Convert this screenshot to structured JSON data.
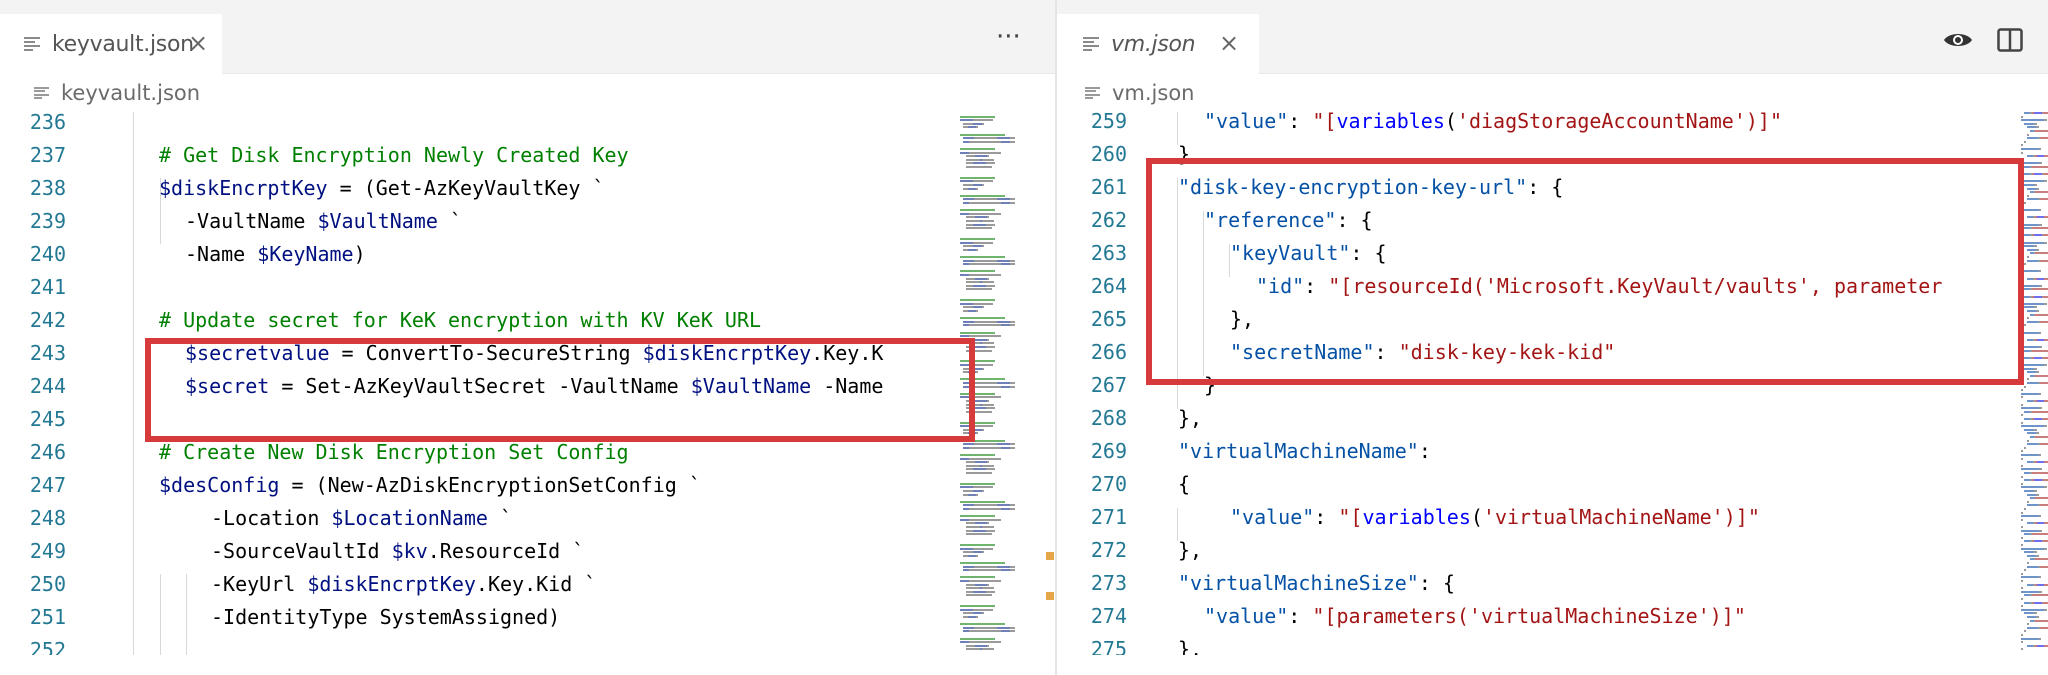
{
  "left_editor": {
    "tab": {
      "label": "keyvault.json",
      "close_glyph": "×"
    },
    "more_actions_glyph": "···",
    "breadcrumb": "keyvault.json",
    "lines": [
      {
        "number": "236",
        "indent": 0,
        "tokens": []
      },
      {
        "number": "237",
        "indent": 0,
        "tokens": [
          {
            "t": "# Get Disk Encryption Newly Created Key",
            "c": "c-comment"
          }
        ]
      },
      {
        "number": "238",
        "indent": 0,
        "tokens": [
          {
            "t": "$diskEncrptKey",
            "c": "c-var"
          },
          {
            "t": " = (Get-AzKeyVaultKey `",
            "c": "c-op"
          }
        ]
      },
      {
        "number": "239",
        "indent": 1,
        "tokens": [
          {
            "t": "-VaultName ",
            "c": "c-op"
          },
          {
            "t": "$VaultName",
            "c": "c-var"
          },
          {
            "t": " `",
            "c": "c-op"
          }
        ]
      },
      {
        "number": "240",
        "indent": 1,
        "tokens": [
          {
            "t": "-Name ",
            "c": "c-op"
          },
          {
            "t": "$KeyName",
            "c": "c-var"
          },
          {
            "t": ")",
            "c": "c-op"
          }
        ]
      },
      {
        "number": "241",
        "indent": 0,
        "tokens": []
      },
      {
        "number": "242",
        "indent": 0,
        "tokens": [
          {
            "t": "# Update secret for KeK encryption with KV KeK URL",
            "c": "c-comment"
          }
        ]
      },
      {
        "number": "243",
        "indent": 1,
        "tokens": [
          {
            "t": "$secretvalue",
            "c": "c-var"
          },
          {
            "t": " = ConvertTo-SecureString ",
            "c": "c-op"
          },
          {
            "t": "$diskEncrptKey",
            "c": "c-var"
          },
          {
            "t": ".Key.K",
            "c": "c-op"
          }
        ]
      },
      {
        "number": "244",
        "indent": 1,
        "tokens": [
          {
            "t": "$secret",
            "c": "c-var"
          },
          {
            "t": " = Set-AzKeyVaultSecret -VaultName ",
            "c": "c-op"
          },
          {
            "t": "$VaultName",
            "c": "c-var"
          },
          {
            "t": " -Name",
            "c": "c-op"
          }
        ]
      },
      {
        "number": "245",
        "indent": 0,
        "tokens": []
      },
      {
        "number": "246",
        "indent": 0,
        "tokens": [
          {
            "t": "# Create New Disk Encryption Set Config",
            "c": "c-comment"
          }
        ]
      },
      {
        "number": "247",
        "indent": 0,
        "tokens": [
          {
            "t": "$desConfig",
            "c": "c-var"
          },
          {
            "t": " = (New-AzDiskEncryptionSetConfig `",
            "c": "c-op"
          }
        ]
      },
      {
        "number": "248",
        "indent": 2,
        "tokens": [
          {
            "t": "-Location ",
            "c": "c-op"
          },
          {
            "t": "$LocationName",
            "c": "c-var"
          },
          {
            "t": " `",
            "c": "c-op"
          }
        ]
      },
      {
        "number": "249",
        "indent": 2,
        "tokens": [
          {
            "t": "-SourceVaultId ",
            "c": "c-op"
          },
          {
            "t": "$kv",
            "c": "c-var"
          },
          {
            "t": ".ResourceId `",
            "c": "c-op"
          }
        ]
      },
      {
        "number": "250",
        "indent": 2,
        "tokens": [
          {
            "t": "-KeyUrl ",
            "c": "c-op"
          },
          {
            "t": "$diskEncrptKey",
            "c": "c-var"
          },
          {
            "t": ".Key.Kid `",
            "c": "c-op"
          }
        ]
      },
      {
        "number": "251",
        "indent": 2,
        "tokens": [
          {
            "t": "-IdentityType SystemAssigned)",
            "c": "c-op"
          }
        ]
      },
      {
        "number": "252",
        "indent": 0,
        "tokens": []
      }
    ]
  },
  "right_editor": {
    "tab": {
      "label": "vm.json",
      "close_glyph": "×"
    },
    "actions": [
      {
        "icon": "eye-icon"
      },
      {
        "icon": "split-editor-icon"
      }
    ],
    "breadcrumb": "vm.json",
    "lines": [
      {
        "number": "259",
        "indent": 1,
        "tokens": [
          {
            "t": "\"value\"",
            "c": "c-key"
          },
          {
            "t": ": ",
            "c": "c-op"
          },
          {
            "t": "\"[",
            "c": "c-str"
          },
          {
            "t": "variables",
            "c": "c-fn"
          },
          {
            "t": "(",
            "c": "c-op"
          },
          {
            "t": "'diagStorageAccountName'",
            "c": "c-str"
          },
          {
            "t": ")]\"",
            "c": "c-str"
          }
        ]
      },
      {
        "number": "260",
        "indent": 0,
        "tokens": [
          {
            "t": "},",
            "c": "c-op"
          }
        ]
      },
      {
        "number": "261",
        "indent": 0,
        "tokens": [
          {
            "t": "\"disk-key-encryption-key-url\"",
            "c": "c-key"
          },
          {
            "t": ": {",
            "c": "c-op"
          }
        ]
      },
      {
        "number": "262",
        "indent": 1,
        "tokens": [
          {
            "t": "\"reference\"",
            "c": "c-key"
          },
          {
            "t": ": {",
            "c": "c-op"
          }
        ]
      },
      {
        "number": "263",
        "indent": 2,
        "tokens": [
          {
            "t": "\"keyVault\"",
            "c": "c-key"
          },
          {
            "t": ": {",
            "c": "c-op"
          }
        ]
      },
      {
        "number": "264",
        "indent": 3,
        "tokens": [
          {
            "t": "\"id\"",
            "c": "c-key"
          },
          {
            "t": ": ",
            "c": "c-op"
          },
          {
            "t": "\"[resourceId(",
            "c": "c-str"
          },
          {
            "t": "'Microsoft.KeyVault/vaults'",
            "c": "c-str"
          },
          {
            "t": ", parameter",
            "c": "c-str"
          }
        ]
      },
      {
        "number": "265",
        "indent": 2,
        "tokens": [
          {
            "t": "},",
            "c": "c-op"
          }
        ]
      },
      {
        "number": "266",
        "indent": 2,
        "tokens": [
          {
            "t": "\"secretName\"",
            "c": "c-key"
          },
          {
            "t": ": ",
            "c": "c-op"
          },
          {
            "t": "\"disk-key-kek-kid\"",
            "c": "c-str"
          }
        ]
      },
      {
        "number": "267",
        "indent": 1,
        "tokens": [
          {
            "t": "}",
            "c": "c-op"
          }
        ]
      },
      {
        "number": "268",
        "indent": 0,
        "tokens": [
          {
            "t": "},",
            "c": "c-op"
          }
        ]
      },
      {
        "number": "269",
        "indent": 0,
        "tokens": [
          {
            "t": "\"virtualMachineName\"",
            "c": "c-key"
          },
          {
            "t": ":",
            "c": "c-op"
          }
        ]
      },
      {
        "number": "270",
        "indent": 0,
        "tokens": [
          {
            "t": "{",
            "c": "c-op"
          }
        ]
      },
      {
        "number": "271",
        "indent": 2,
        "tokens": [
          {
            "t": "\"value\"",
            "c": "c-key"
          },
          {
            "t": ": ",
            "c": "c-op"
          },
          {
            "t": "\"[",
            "c": "c-str"
          },
          {
            "t": "variables",
            "c": "c-fn"
          },
          {
            "t": "(",
            "c": "c-op"
          },
          {
            "t": "'virtualMachineName'",
            "c": "c-str"
          },
          {
            "t": ")]\"",
            "c": "c-str"
          }
        ]
      },
      {
        "number": "272",
        "indent": 0,
        "tokens": [
          {
            "t": "},",
            "c": "c-op"
          }
        ]
      },
      {
        "number": "273",
        "indent": 0,
        "tokens": [
          {
            "t": "\"virtualMachineSize\"",
            "c": "c-key"
          },
          {
            "t": ": {",
            "c": "c-op"
          }
        ]
      },
      {
        "number": "274",
        "indent": 1,
        "tokens": [
          {
            "t": "\"value\"",
            "c": "c-key"
          },
          {
            "t": ": ",
            "c": "c-op"
          },
          {
            "t": "\"[parameters('virtualMachineSize')]\"",
            "c": "c-str"
          }
        ]
      },
      {
        "number": "275",
        "indent": 0,
        "tokens": [
          {
            "t": "},",
            "c": "c-op"
          }
        ]
      }
    ]
  },
  "colors": {
    "highlight": "#d63a3a",
    "line_number": "#237893",
    "comment": "#008000",
    "variable": "#001080",
    "json_key": "#0451a5",
    "string": "#a31515",
    "function": "#0000ff"
  }
}
